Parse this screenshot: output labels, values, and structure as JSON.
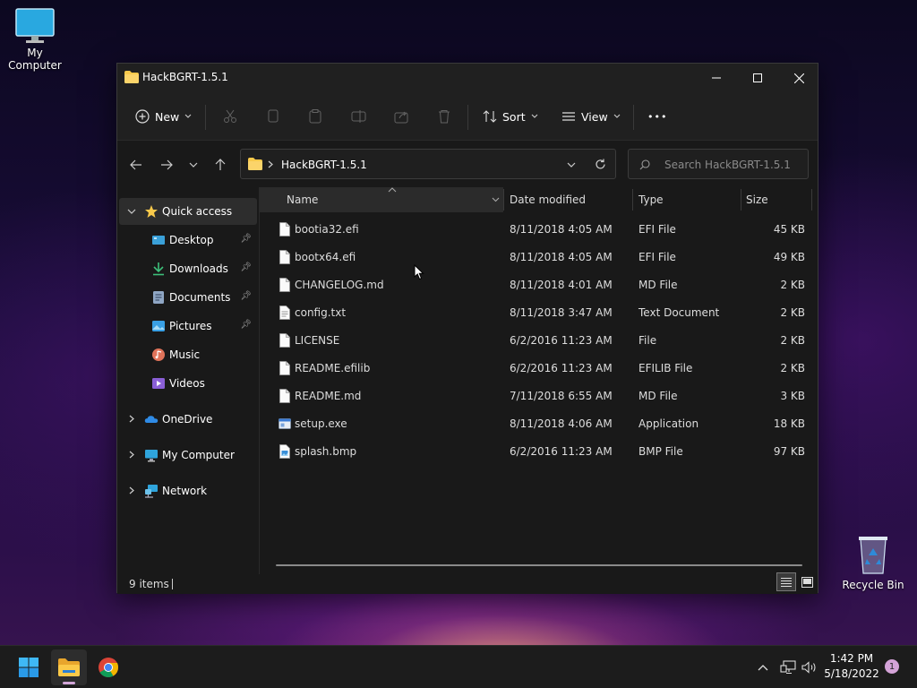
{
  "desktop": {
    "my_computer_label": "My Computer",
    "recycle_bin_label": "Recycle Bin"
  },
  "window": {
    "title": "HackBGRT-1.5.1",
    "controls": [
      "minimize-icon",
      "maximize-icon",
      "close-icon"
    ]
  },
  "toolbar": {
    "new_label": "New",
    "sort_label": "Sort",
    "view_label": "View",
    "more_glyph": "•••"
  },
  "nav": {
    "address_crumb": "HackBGRT-1.5.1",
    "search_placeholder": "Search HackBGRT-1.5.1"
  },
  "sidebar": {
    "items": [
      {
        "label": "Quick access",
        "icon": "star-icon"
      },
      {
        "label": "Desktop",
        "icon": "desktop-icon",
        "pinned": true
      },
      {
        "label": "Downloads",
        "icon": "download-icon",
        "pinned": true
      },
      {
        "label": "Documents",
        "icon": "document-icon",
        "pinned": true
      },
      {
        "label": "Pictures",
        "icon": "picture-icon",
        "pinned": true
      },
      {
        "label": "Music",
        "icon": "music-icon"
      },
      {
        "label": "Videos",
        "icon": "video-icon"
      },
      {
        "label": "OneDrive",
        "icon": "cloud-icon"
      },
      {
        "label": "My Computer",
        "icon": "computer-icon"
      },
      {
        "label": "Network",
        "icon": "network-icon"
      }
    ]
  },
  "columns": {
    "name": "Name",
    "date": "Date modified",
    "type": "Type",
    "size": "Size"
  },
  "files": [
    {
      "name": "bootia32.efi",
      "date": "8/11/2018 4:05 AM",
      "type": "EFI File",
      "size": "45 KB"
    },
    {
      "name": "bootx64.efi",
      "date": "8/11/2018 4:05 AM",
      "type": "EFI File",
      "size": "49 KB"
    },
    {
      "name": "CHANGELOG.md",
      "date": "8/11/2018 4:01 AM",
      "type": "MD File",
      "size": "2 KB"
    },
    {
      "name": "config.txt",
      "date": "8/11/2018 3:47 AM",
      "type": "Text Document",
      "size": "2 KB"
    },
    {
      "name": "LICENSE",
      "date": "6/2/2016 11:23 AM",
      "type": "File",
      "size": "2 KB"
    },
    {
      "name": "README.efilib",
      "date": "6/2/2016 11:23 AM",
      "type": "EFILIB File",
      "size": "2 KB"
    },
    {
      "name": "README.md",
      "date": "7/11/2018 6:55 AM",
      "type": "MD File",
      "size": "3 KB"
    },
    {
      "name": "setup.exe",
      "date": "8/11/2018 4:06 AM",
      "type": "Application",
      "size": "18 KB"
    },
    {
      "name": "splash.bmp",
      "date": "6/2/2016 11:23 AM",
      "type": "BMP File",
      "size": "97 KB"
    }
  ],
  "status": {
    "item_count": "9 items"
  },
  "taskbar": {
    "time": "1:42 PM",
    "date": "5/18/2022",
    "notification_count": "1"
  },
  "colors": {
    "accent": "#0078d4",
    "folder": "#f8c94b"
  }
}
